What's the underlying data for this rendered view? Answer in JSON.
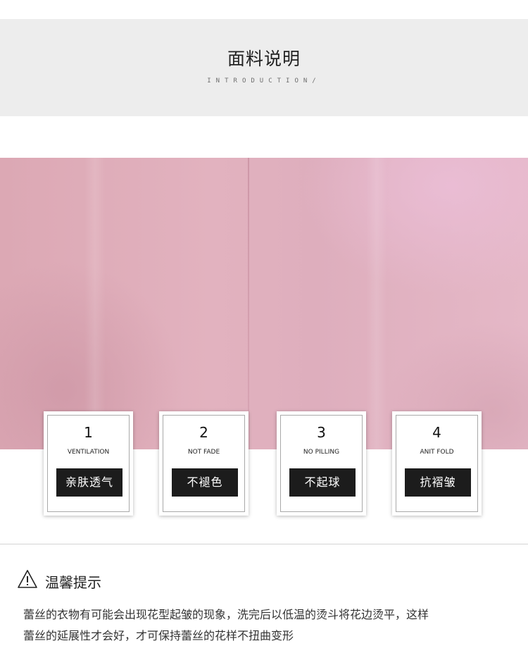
{
  "header": {
    "title_cn": "面料说明",
    "title_en": "INTRODUCTION/"
  },
  "fabric": {
    "description": "pink-fabric-swatch",
    "color": "#e0b0bd"
  },
  "features": [
    {
      "number": "1",
      "label_en": "VENTILATION",
      "label_cn": "亲肤透气"
    },
    {
      "number": "2",
      "label_en": "NOT FADE",
      "label_cn": "不褪色"
    },
    {
      "number": "3",
      "label_en": "NO PILLING",
      "label_cn": "不起球"
    },
    {
      "number": "4",
      "label_en": "ANIT FOLD",
      "label_cn": "抗褶皱"
    }
  ],
  "tips": {
    "icon": "warning-icon",
    "title": "温馨提示",
    "lines": [
      "蕾丝的衣物有可能会出现花型起皱的现象，洗完后以低温的烫斗将花边烫平，这样",
      "蕾丝的延展性才会好，才可保持蕾丝的花样不扭曲变形"
    ]
  },
  "colors": {
    "band_bg": "#ededed",
    "label_bg": "#1c1c1c",
    "label_text": "#ffffff"
  }
}
